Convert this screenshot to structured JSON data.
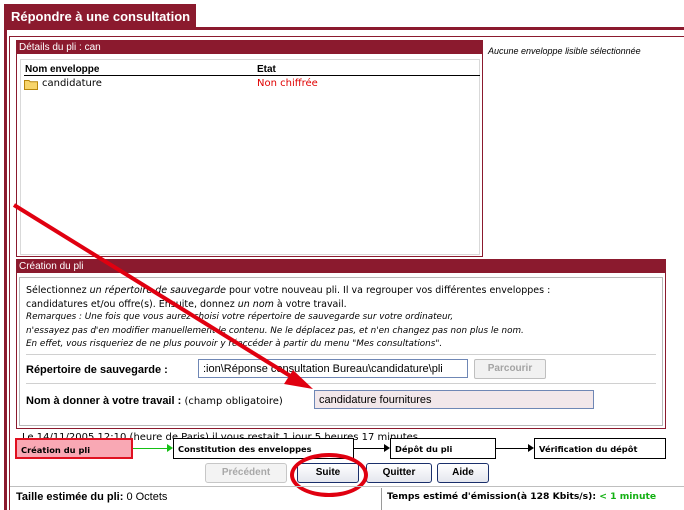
{
  "window": {
    "title": "Répondre à une consultation"
  },
  "details": {
    "header": "Détails du pli : can",
    "columns": [
      "Nom enveloppe",
      "Etat"
    ],
    "rows": [
      {
        "name": "candidature",
        "state": "Non chiffrée"
      }
    ],
    "side_note": "Aucune enveloppe lisible sélectionnée"
  },
  "creation": {
    "header": "Création du pli",
    "desc": {
      "line1_a": "Sélectionnez ",
      "line1_b": "un répertoire de sauvegarde",
      "line1_c": " pour votre nouveau pli. Il va regrouper vos différentes enveloppes :",
      "line2_a": "candidatures et/ou offre(s). Ensuite, donnez ",
      "line2_b": "un nom",
      "line2_c": " à votre travail.",
      "line3": "Remarques : Une fois que vous aurez choisi votre répertoire de sauvegarde sur votre ordinateur,",
      "line4": "n'essayez pas d'en modifier manuellement le contenu. Ne le déplacez pas, et n'en changez pas non plus le nom.",
      "line5": "En effet, vous risqueriez de ne plus pouvoir y réaccéder à partir du menu \"Mes consultations\"."
    },
    "dir_label": "Répertoire de sauvegarde :",
    "dir_value": ":ion\\Réponse consultation Bureau\\candidature\\pli",
    "browse_label": "Parcourir",
    "name_label": "Nom à donner à votre travail :",
    "name_hint": " (champ obligatoire)",
    "name_value": "candidature fournitures",
    "deadline": "Le 14/11/2005 12:10 (heure de Paris) il vous restait 1 jour 5 heures 17 minutes."
  },
  "steps": [
    "Création du pli",
    "Constitution des enveloppes",
    "Dépôt du pli",
    "Vérification du dépôt"
  ],
  "buttons": {
    "prev": "Précédent",
    "next": "Suite",
    "quit": "Quitter",
    "help": "Aide"
  },
  "status": {
    "size_label": "Taille estimée du pli:",
    "size_value": " 0 Octets",
    "time_label": "Temps estimé d'émission(à 128 Kbits/s): ",
    "time_value": "< 1 minute"
  },
  "colors": {
    "brand": "#8b1a2e",
    "accent_red": "#e00010",
    "ok_green": "#12b012",
    "active_step": "#f9a8b4"
  }
}
